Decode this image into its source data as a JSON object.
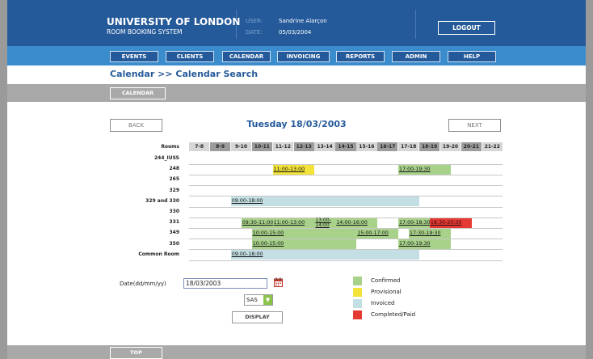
{
  "header": {
    "title": "UNIVERSITY OF LONDON",
    "subtitle": "ROOM BOOKING SYSTEM",
    "user_label": "USER:",
    "user_value": "Sandrine Alarçon",
    "date_label": "DATE:",
    "date_value": "05/03/2004",
    "logout_label": "LOGOUT"
  },
  "nav": {
    "items": [
      "EVENTS",
      "CLIENTS",
      "CALENDAR",
      "INVOICING",
      "REPORTS",
      "ADMIN",
      "HELP"
    ]
  },
  "page_title": "Calendar >> Calendar Search",
  "subbar": {
    "calendar_label": "CALENDAR"
  },
  "calendar": {
    "back_label": "BACK",
    "next_label": "NEXT",
    "date_heading": "Tuesday  18/03/2003",
    "rooms_header": "Rooms",
    "time_slots": [
      "7-8",
      "8-9",
      "9-10",
      "10-11",
      "11-12",
      "12-13",
      "13-14",
      "14-15",
      "15-16",
      "16-17",
      "17-18",
      "18-19",
      "19-20",
      "20-21",
      "21-22"
    ],
    "rooms": [
      {
        "name": "244_IUSS",
        "bookings": []
      },
      {
        "name": "248",
        "bookings": [
          {
            "label": "11:00-13:00",
            "start": 11,
            "end": 13,
            "status": "Provisional"
          },
          {
            "label": "17:00-19:30",
            "start": 17,
            "end": 19.5,
            "status": "Confirmed"
          }
        ]
      },
      {
        "name": "265",
        "bookings": []
      },
      {
        "name": "329",
        "bookings": []
      },
      {
        "name": "329 and 330",
        "bookings": [
          {
            "label": "09:00-18:00",
            "start": 9,
            "end": 18,
            "status": "Invoiced"
          }
        ]
      },
      {
        "name": "330",
        "bookings": []
      },
      {
        "name": "331",
        "bookings": [
          {
            "label": "09:30-11:00",
            "start": 9.5,
            "end": 11,
            "status": "Confirmed"
          },
          {
            "label": "11:00-13:00",
            "start": 11,
            "end": 13,
            "status": "Confirmed"
          },
          {
            "label": "13:00-14:00",
            "start": 13,
            "end": 14,
            "status": "Confirmed"
          },
          {
            "label": "14:00-16:00",
            "start": 14,
            "end": 16,
            "status": "Confirmed"
          },
          {
            "label": "17:00-18:30",
            "start": 17,
            "end": 18.5,
            "status": "Confirmed"
          },
          {
            "label": "18:30-20:30",
            "start": 18.5,
            "end": 20.5,
            "status": "Completed/Paid"
          }
        ]
      },
      {
        "name": "349",
        "bookings": [
          {
            "label": "10:00-15:00",
            "start": 10,
            "end": 15,
            "status": "Confirmed"
          },
          {
            "label": "15:00-17:00",
            "start": 15,
            "end": 17,
            "status": "Confirmed"
          },
          {
            "label": "17:30-19:30",
            "start": 17.5,
            "end": 19.5,
            "status": "Confirmed"
          }
        ]
      },
      {
        "name": "350",
        "bookings": [
          {
            "label": "10:00-15:00",
            "start": 10,
            "end": 15,
            "status": "Confirmed"
          },
          {
            "label": "17:00-19:30",
            "start": 17,
            "end": 19.5,
            "status": "Confirmed"
          }
        ]
      },
      {
        "name": "Common Room",
        "bookings": [
          {
            "label": "09:00-18:00",
            "start": 9,
            "end": 18,
            "status": "Invoiced"
          }
        ]
      }
    ]
  },
  "search": {
    "date_label": "Date(dd/mm/yy)",
    "date_value": "18/03/2003",
    "site_value": "SAS",
    "display_label": "DISPLAY"
  },
  "legend": [
    {
      "label": "Confirmed",
      "color": "#a8d28a"
    },
    {
      "label": "Provisional",
      "color": "#f2e23a"
    },
    {
      "label": "Invoiced",
      "color": "#c3dfe3"
    },
    {
      "label": "Completed/Paid",
      "color": "#e53a34"
    }
  ],
  "colors": {
    "Confirmed": "#a8d28a",
    "Provisional": "#f2e23a",
    "Invoiced": "#c3dfe3",
    "Completed/Paid": "#e53a34",
    "header_blue": "#255a9a",
    "nav_blue": "#3a8ccc"
  },
  "footer": {
    "top_label": "TOP"
  }
}
